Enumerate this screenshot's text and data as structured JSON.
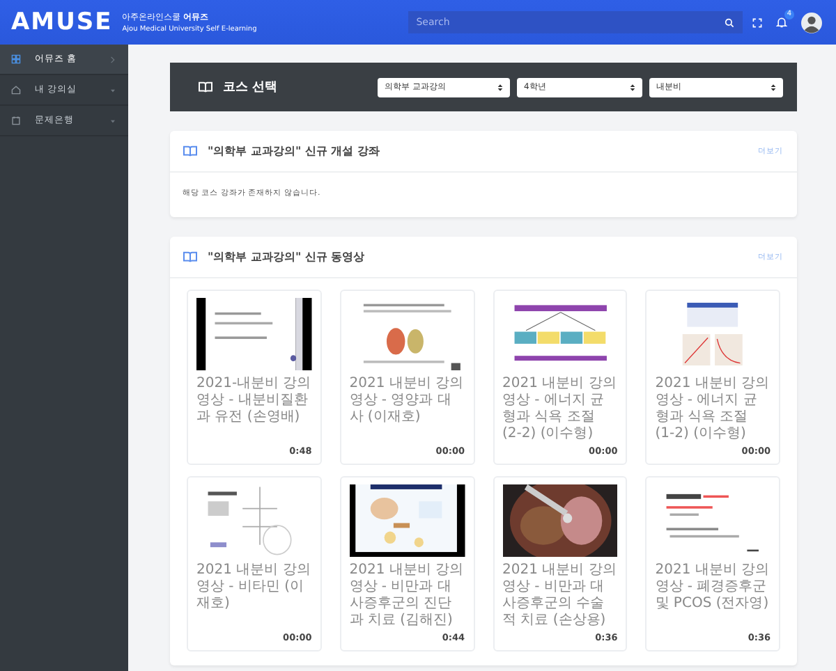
{
  "header": {
    "logo": "AMUSE",
    "school": "아주온라인스쿨 **어뮤즈**",
    "tagline": "Ajou Medical University Self E-learning",
    "search": {
      "placeholder": "Search"
    },
    "notification_count": "4"
  },
  "sidebar": {
    "items": [
      {
        "label": "어뮤즈 홈",
        "kind": "link",
        "selected": true
      },
      {
        "label": "내 강의실",
        "kind": "submenu",
        "selected": false
      },
      {
        "label": "문제은행",
        "kind": "submenu",
        "selected": false
      }
    ]
  },
  "course_select": {
    "title": "코스 선택",
    "dropdowns": [
      "의학부 교과강의",
      "4학년",
      "내분비"
    ]
  },
  "new_courses": {
    "title": "\"의학부 교과강의\" 신규 개설 강좌",
    "more": "더보기",
    "empty_message": "해당 코스 강좌가 존재하지 않습니다."
  },
  "new_videos": {
    "title": "\"의학부 교과강의\" 신규 동영상",
    "more": "더보기",
    "videos": [
      {
        "title": "2021-내분비 강의영상 - 내분비질환과 유전 (손영배)",
        "duration": "0:48"
      },
      {
        "title": "2021 내분비 강의영상 - 영양과 대사 (이재호)",
        "duration": "00:00"
      },
      {
        "title": "2021 내분비 강의영상 - 에너지 균형과 식욕 조절 (2-2) (이수형)",
        "duration": "00:00"
      },
      {
        "title": "2021 내분비 강의영상 - 에너지 균형과 식욕 조절 (1-2) (이수형)",
        "duration": "00:00"
      },
      {
        "title": "2021 내분비 강의영상 - 비타민 (이재호)",
        "duration": "00:00"
      },
      {
        "title": "2021 내분비 강의영상 - 비만과 대사증후군의 진단과 치료 (김해진)",
        "duration": "0:44"
      },
      {
        "title": "2021 내분비 강의영상 - 비만과 대사증후군의 수술적 치료 (손상용)",
        "duration": "0:36"
      },
      {
        "title": "2021 내분비 강의영상 - 폐경증후군 및 PCOS (전자영)",
        "duration": "0:36"
      }
    ]
  }
}
